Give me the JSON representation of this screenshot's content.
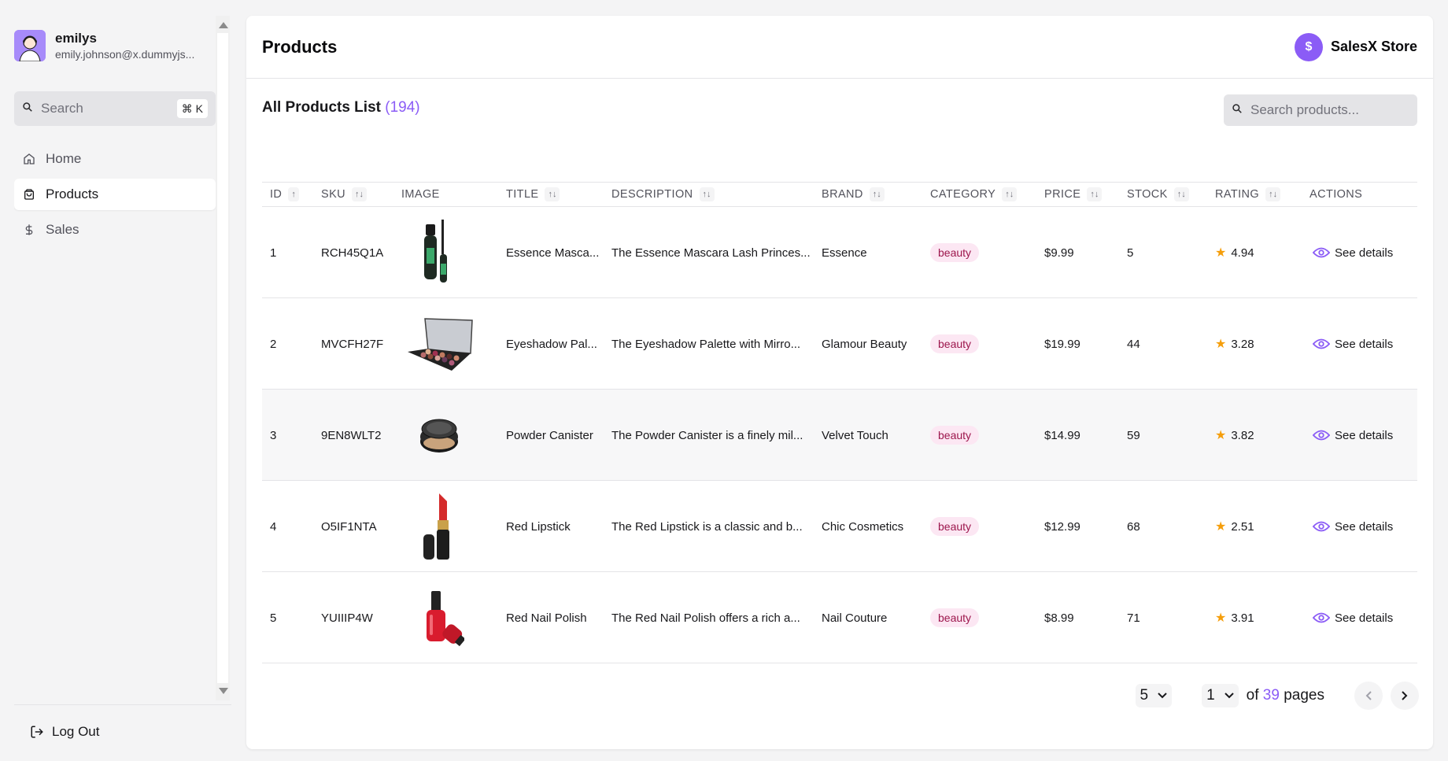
{
  "user": {
    "name": "emilys",
    "email": "emily.johnson@x.dummyjs..."
  },
  "sidebar": {
    "search_placeholder": "Search",
    "shortcut": "⌘ K",
    "items": [
      {
        "label": "Home",
        "icon": "home-icon"
      },
      {
        "label": "Products",
        "icon": "shopping-bag-icon",
        "active": true
      },
      {
        "label": "Sales",
        "icon": "dollar-icon"
      }
    ],
    "logout_label": "Log Out"
  },
  "header": {
    "title": "Products",
    "store_name": "SalesX Store",
    "store_icon": "$"
  },
  "list": {
    "title": "All Products List",
    "count": "(194)",
    "search_placeholder": "Search products..."
  },
  "table": {
    "columns": [
      "ID",
      "SKU",
      "IMAGE",
      "TITLE",
      "DESCRIPTION",
      "BRAND",
      "CATEGORY",
      "PRICE",
      "STOCK",
      "RATING",
      "ACTIONS"
    ],
    "rows": [
      {
        "id": "1",
        "sku": "RCH45Q1A",
        "image": "mascara",
        "title": "Essence Masca...",
        "description": "The Essence Mascara Lash Princes...",
        "brand": "Essence",
        "category": "beauty",
        "price": "$9.99",
        "stock": "5",
        "rating": "4.94",
        "action": "See details"
      },
      {
        "id": "2",
        "sku": "MVCFH27F",
        "image": "eyeshadow-palette",
        "title": "Eyeshadow Pal...",
        "description": "The Eyeshadow Palette with Mirro...",
        "brand": "Glamour Beauty",
        "category": "beauty",
        "price": "$19.99",
        "stock": "44",
        "rating": "3.28",
        "action": "See details"
      },
      {
        "id": "3",
        "sku": "9EN8WLT2",
        "image": "powder-canister",
        "title": "Powder Canister",
        "description": "The Powder Canister is a finely mil...",
        "brand": "Velvet Touch",
        "category": "beauty",
        "price": "$14.99",
        "stock": "59",
        "rating": "3.82",
        "action": "See details"
      },
      {
        "id": "4",
        "sku": "O5IF1NTA",
        "image": "red-lipstick",
        "title": "Red Lipstick",
        "description": "The Red Lipstick is a classic and b...",
        "brand": "Chic Cosmetics",
        "category": "beauty",
        "price": "$12.99",
        "stock": "68",
        "rating": "2.51",
        "action": "See details"
      },
      {
        "id": "5",
        "sku": "YUIIIP4W",
        "image": "red-nail-polish",
        "title": "Red Nail Polish",
        "description": "The Red Nail Polish offers a rich a...",
        "brand": "Nail Couture",
        "category": "beauty",
        "price": "$8.99",
        "stock": "71",
        "rating": "3.91",
        "action": "See details"
      }
    ]
  },
  "pagination": {
    "page_size": "5",
    "current_page": "1",
    "of_label": "of",
    "total_pages": "39",
    "pages_label": "pages"
  },
  "colors": {
    "accent": "#8b5cf6",
    "badge_bg": "#fce7f3",
    "badge_text": "#9d174d",
    "star": "#f59e0b"
  }
}
